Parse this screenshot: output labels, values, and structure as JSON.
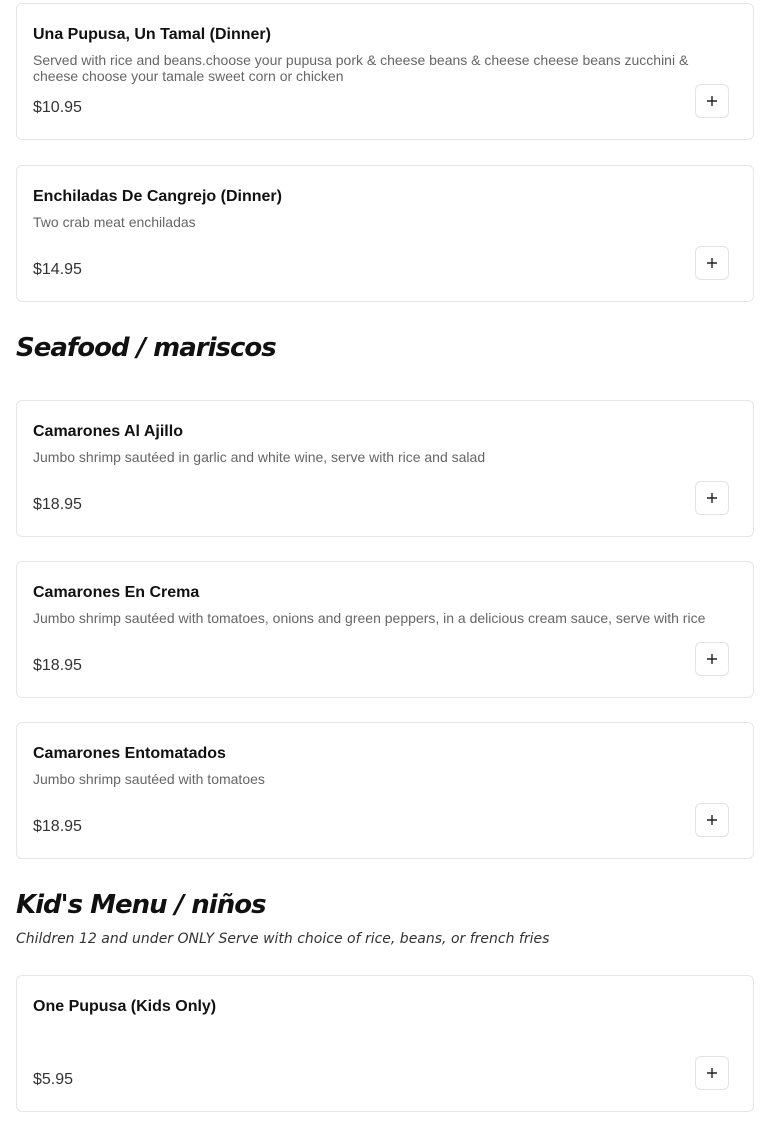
{
  "sections": [
    {
      "title": "",
      "items": [
        {
          "name": "Una Pupusa, Un Tamal (Dinner)",
          "description": "Served with rice and beans.choose your pupusa pork & cheese beans & cheese cheese beans zucchini & cheese choose your tamale sweet corn or chicken",
          "price": "$10.95"
        },
        {
          "name": "Enchiladas De Cangrejo (Dinner)",
          "description": "Two crab meat enchiladas",
          "price": "$14.95"
        }
      ]
    },
    {
      "title": "Seafood / mariscos",
      "items": [
        {
          "name": "Camarones Al Ajillo",
          "description": "Jumbo shrimp sautéed in garlic and white wine, serve with rice and salad",
          "price": "$18.95"
        },
        {
          "name": "Camarones En Crema",
          "description": "Jumbo shrimp sautéed with tomatoes, onions and green peppers, in a delicious cream sauce, serve with rice",
          "price": "$18.95"
        },
        {
          "name": "Camarones Entomatados",
          "description": "Jumbo shrimp sautéed with tomatoes",
          "price": "$18.95"
        }
      ]
    },
    {
      "title": "Kid's Menu / niños",
      "note": "Children 12 and under ONLY Serve with choice of rice, beans, or french fries",
      "items": [
        {
          "name": "One Pupusa (Kids Only)",
          "description": "",
          "price": "$5.95"
        }
      ]
    }
  ],
  "icons": {
    "add": "plus-icon"
  }
}
